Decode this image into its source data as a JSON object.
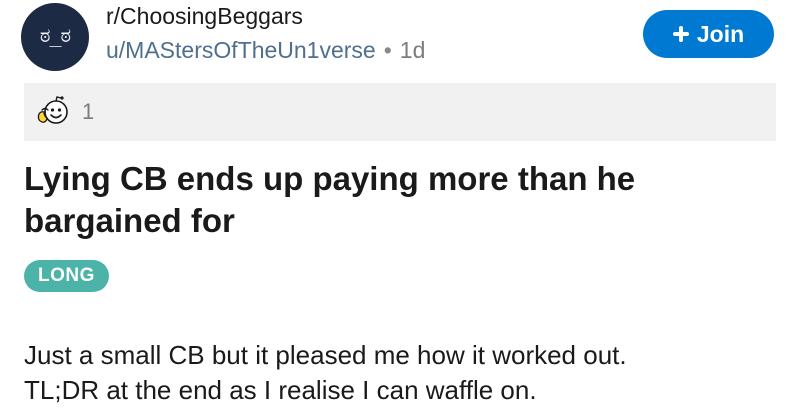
{
  "header": {
    "avatar_face": "ಠ_ಠ",
    "subreddit": "r/ChoosingBeggars",
    "username": "u/MAStersOfTheUn1verse",
    "separator": "•",
    "age": "1d",
    "join_label": "Join",
    "join_color": "#0079d3"
  },
  "awards": {
    "icon": "wholesome-award-icon",
    "count": "1"
  },
  "post": {
    "title": "Lying CB ends up paying more than he bargained for",
    "flair": "LONG",
    "flair_color": "#4bb3a8",
    "body_lines": [
      "Just a small CB but it pleased me how it worked out.",
      "TL;DR at the end as I realise I can waffle on."
    ]
  }
}
